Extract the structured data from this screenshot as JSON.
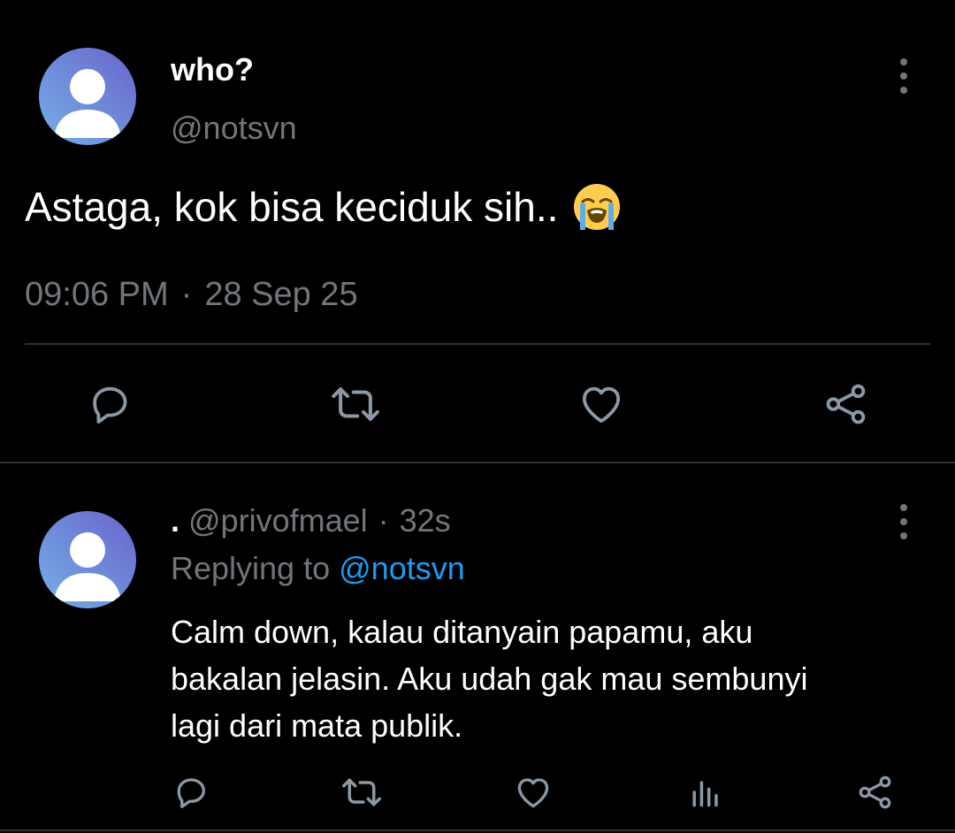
{
  "main_tweet": {
    "display_name": "who?",
    "handle": "@notsvn",
    "text": "Astaga, kok bisa keciduk sih..",
    "emoji": "loudly-crying-face-emoji",
    "time": "09:06 PM",
    "separator": "·",
    "date": "28 Sep 25",
    "actions": [
      "reply-icon",
      "retweet-icon",
      "like-icon",
      "share-icon"
    ]
  },
  "reply_tweet": {
    "display_name": ".",
    "handle": "@privofmael",
    "separator": "·",
    "age": "32s",
    "replying_prefix": "Replying to",
    "replying_to": "@notsvn",
    "text_lines": [
      "Calm down, kalau ditanyain papamu, aku",
      "bakalan jelasin. Aku udah gak mau sembunyi",
      "lagi dari mata publik."
    ],
    "actions": [
      "reply-icon",
      "retweet-icon",
      "like-icon",
      "analytics-icon",
      "share-icon"
    ]
  },
  "colors": {
    "background": "#000000",
    "text_primary": "#ffffff",
    "text_secondary": "#71767b",
    "accent": "#1d9bf0",
    "divider": "#2f3336",
    "avatar_gradient_start": "#6fa6e0",
    "avatar_gradient_end": "#6a6fd0"
  }
}
